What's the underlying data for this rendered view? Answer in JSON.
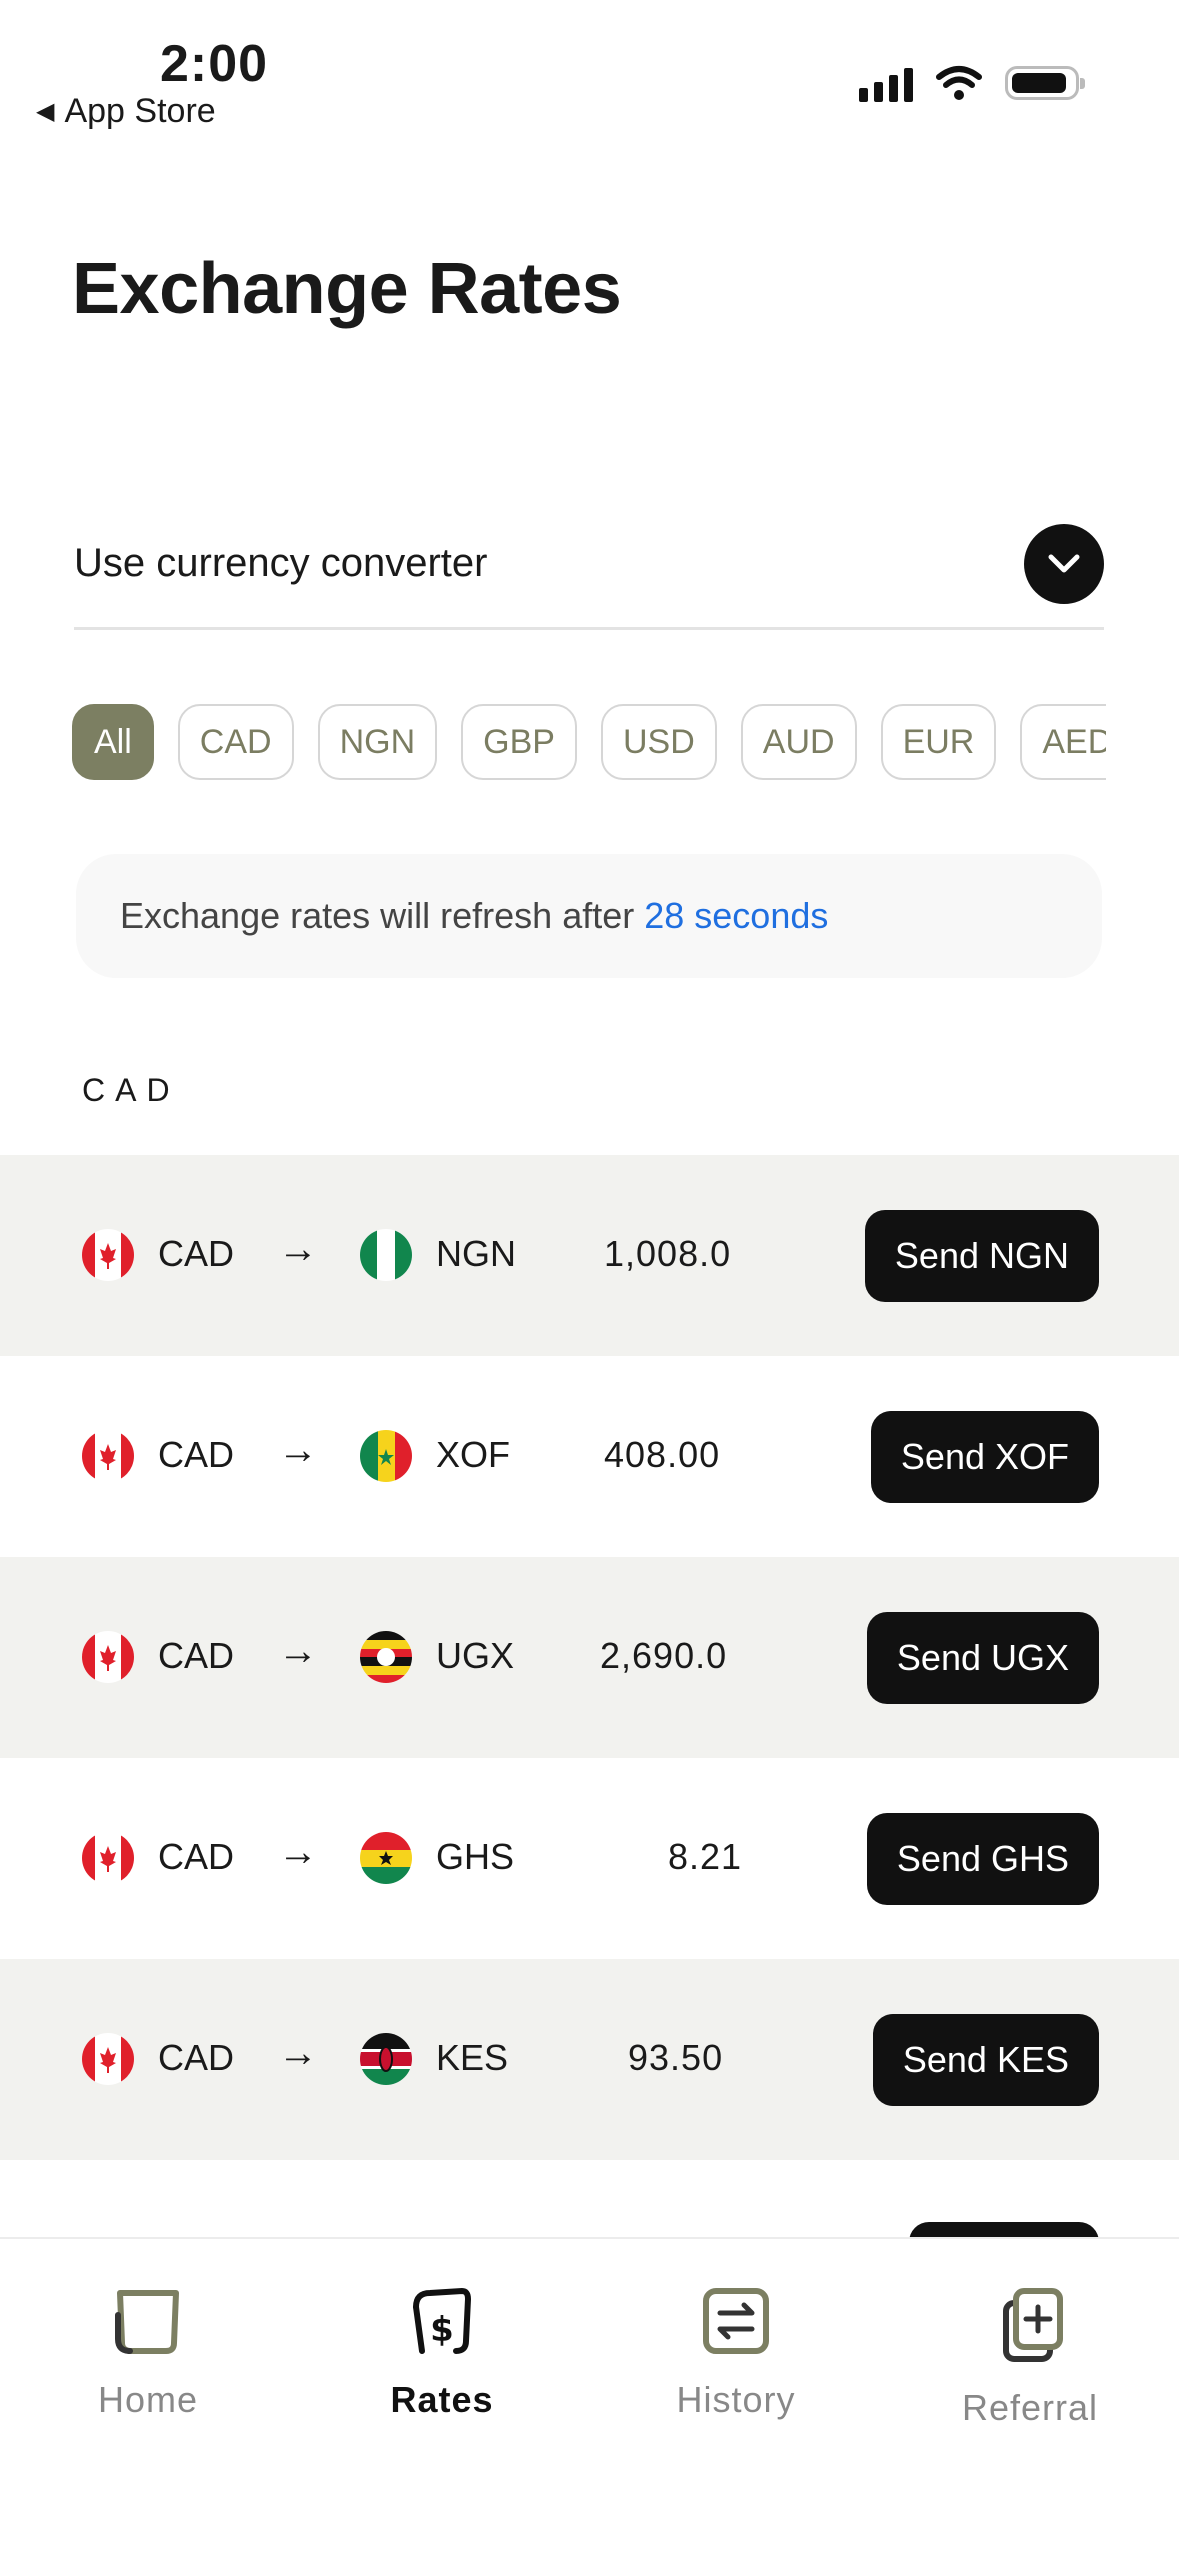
{
  "status": {
    "time": "2:00",
    "back_label": "App Store"
  },
  "title": "Exchange Rates",
  "converter": {
    "label": "Use currency converter"
  },
  "chips": [
    "All",
    "CAD",
    "NGN",
    "GBP",
    "USD",
    "AUD",
    "EUR",
    "AED"
  ],
  "notice": {
    "text": "Exchange rates will refresh after",
    "seconds": "28 seconds"
  },
  "section_label": "CAD",
  "rows": [
    {
      "from": "CAD",
      "to": "NGN",
      "rate": "1,008.0",
      "send": "Send NGN"
    },
    {
      "from": "CAD",
      "to": "XOF",
      "rate": "408.00",
      "send": "Send XOF"
    },
    {
      "from": "CAD",
      "to": "UGX",
      "rate": "2,690.0",
      "send": "Send UGX"
    },
    {
      "from": "CAD",
      "to": "GHS",
      "rate": "8.21",
      "send": "Send GHS"
    },
    {
      "from": "CAD",
      "to": "KES",
      "rate": "93.50",
      "send": "Send KES"
    }
  ],
  "tabs": [
    {
      "label": "Home"
    },
    {
      "label": "Rates"
    },
    {
      "label": "History"
    },
    {
      "label": "Referral"
    }
  ],
  "colors": {
    "accent": "#7c7f62",
    "link": "#1f6fe0",
    "row_shade": "#f2f2ef"
  }
}
